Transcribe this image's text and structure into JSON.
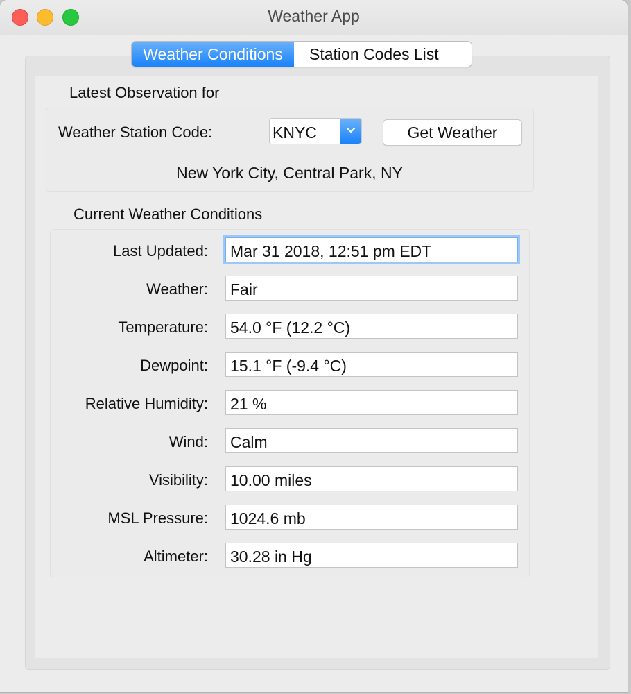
{
  "window": {
    "title": "Weather App"
  },
  "tabs": [
    {
      "label": "Weather Conditions",
      "active": true
    },
    {
      "label": "Station Codes List",
      "active": false
    }
  ],
  "observation": {
    "section_label": "Latest Observation for",
    "station_label": "Weather Station Code:",
    "station_value": "KNYC",
    "get_button": "Get Weather",
    "location": "New York City, Central Park, NY"
  },
  "conditions": {
    "section_label": "Current Weather Conditions",
    "rows": [
      {
        "label": "Last Updated:",
        "value": "Mar 31 2018, 12:51 pm EDT"
      },
      {
        "label": "Weather:",
        "value": "Fair"
      },
      {
        "label": "Temperature:",
        "value": "54.0 °F  (12.2 °C)"
      },
      {
        "label": "Dewpoint:",
        "value": "15.1 °F  (-9.4 °C)"
      },
      {
        "label": "Relative Humidity:",
        "value": "21 %"
      },
      {
        "label": "Wind:",
        "value": "Calm"
      },
      {
        "label": "Visibility:",
        "value": "10.00 miles"
      },
      {
        "label": "MSL Pressure:",
        "value": "1024.6 mb"
      },
      {
        "label": "Altimeter:",
        "value": "30.28 in Hg"
      }
    ]
  },
  "colors": {
    "accent": "#1a82fb",
    "focus_ring": "#9bc8f8"
  }
}
